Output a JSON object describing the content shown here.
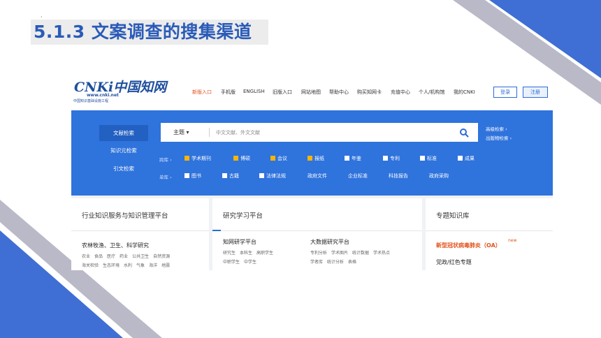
{
  "slide": {
    "title": "5.1.3 文案调查的搜集渠道",
    "colors": {
      "accent": "#2a5bb8",
      "stripe_dark": "#3f6fd4",
      "stripe_light": "#b9b9c7"
    }
  },
  "cnki": {
    "logo": {
      "main": "CNKi中国知网",
      "url": "www.cnki.net",
      "sub": "中国知识基础设施工程"
    },
    "nav": [
      "新版入口",
      "手机版",
      "ENGLISH",
      "旧版入口",
      "网站地图",
      "帮助中心",
      "购买知网卡",
      "充值中心",
      "个人/机构馆",
      "我的CNKI"
    ],
    "login_label": "登录",
    "register_label": "注册",
    "tabs": [
      "文献检索",
      "知识元检索",
      "引文检索"
    ],
    "search": {
      "scope": "主题 ▾",
      "placeholder": "中文文献、外文文献"
    },
    "advanced_search": "高级检索  ›",
    "publication_search": "出版物检索  ›",
    "cross_db_label": "跨库 ›",
    "single_db_label": "单库 ›",
    "cross_db": [
      {
        "label": "学术期刊",
        "checked": true
      },
      {
        "label": "博硕",
        "checked": true
      },
      {
        "label": "会议",
        "checked": true
      },
      {
        "label": "报纸",
        "checked": true
      },
      {
        "label": "年鉴",
        "checked": false
      },
      {
        "label": "专利",
        "checked": false
      },
      {
        "label": "标准",
        "checked": false
      },
      {
        "label": "成果",
        "checked": false
      }
    ],
    "single_db": [
      {
        "label": "图书",
        "checked": false
      },
      {
        "label": "古籍",
        "checked": false
      },
      {
        "label": "法律法规",
        "checked": false
      },
      {
        "label": "政府文件"
      },
      {
        "label": "企业标准"
      },
      {
        "label": "科技报告"
      },
      {
        "label": "政府采购"
      }
    ],
    "panels": {
      "industry": {
        "title": "行业知识服务与知识管理平台",
        "sub": "农林牧渔、卫生、科学研究",
        "row1": [
          "农业",
          "食品",
          "医疗",
          "药业",
          "公共卫生",
          "自然资源"
        ],
        "row2": [
          "海关检验",
          "生态环境",
          "水利",
          "气象",
          "海洋",
          "地震"
        ]
      },
      "research": {
        "title": "研究学习平台",
        "left_title": "知网研学平台",
        "left_row1": [
          "研究生",
          "本科生",
          "高职学生"
        ],
        "left_row2": [
          "中职学生",
          "中学生"
        ],
        "right_title": "大数据研究平台",
        "right_row1": [
          "专利分析",
          "学术图片",
          "统计数据",
          "学术热点"
        ],
        "right_row2": [
          "学者库",
          "统计分析",
          "表格"
        ]
      },
      "topic": {
        "title": "专题知识库",
        "highlight": "新型冠状病毒肺炎（OA）",
        "new_badge": "new",
        "sub": "党政/红色专题"
      }
    }
  }
}
